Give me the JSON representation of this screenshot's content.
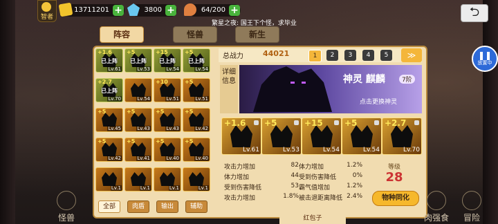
{
  "header": {
    "hint_label": "智者",
    "resources": [
      {
        "icon": "gold-icon",
        "value": "13711201"
      },
      {
        "icon": "diamond-icon",
        "value": "3800"
      },
      {
        "icon": "meat-icon",
        "value": "64/200"
      }
    ],
    "ticker": "繁星之夜: 国王下个怪，求毕业",
    "back_icon": "return-icon"
  },
  "tabs": [
    {
      "label": "阵容",
      "active": true
    },
    {
      "label": "怪兽",
      "active": false
    },
    {
      "label": "新生",
      "active": false
    }
  ],
  "roster": [
    {
      "plus": "+1.6",
      "status": "已上阵",
      "lv": "Lv.61",
      "on": true
    },
    {
      "plus": "+5",
      "status": "已上阵",
      "lv": "Lv.53",
      "on": true
    },
    {
      "plus": "+15",
      "status": "已上阵",
      "lv": "Lv.54",
      "on": true
    },
    {
      "plus": "+5",
      "status": "已上阵",
      "lv": "Lv.54",
      "on": true
    },
    {
      "plus": "+2.7",
      "status": "已上阵",
      "lv": "Lv.70",
      "on": true
    },
    {
      "plus": "",
      "status": "",
      "lv": "Lv.54",
      "on": false
    },
    {
      "plus": "+10",
      "status": "",
      "lv": "Lv.51",
      "on": false
    },
    {
      "plus": "+5",
      "status": "",
      "lv": "Lv.51",
      "on": false
    },
    {
      "plus": "+5",
      "status": "",
      "lv": "Lv.45",
      "on": false
    },
    {
      "plus": "+5",
      "status": "",
      "lv": "Lv.43",
      "on": false
    },
    {
      "plus": "+5",
      "status": "",
      "lv": "Lv.43",
      "on": false
    },
    {
      "plus": "+5",
      "status": "",
      "lv": "Lv.42",
      "on": false
    },
    {
      "plus": "+5",
      "status": "",
      "lv": "Lv.42",
      "on": false
    },
    {
      "plus": "+5",
      "status": "",
      "lv": "Lv.41",
      "on": false
    },
    {
      "plus": "+5",
      "status": "",
      "lv": "Lv.40",
      "on": false
    },
    {
      "plus": "+5",
      "status": "",
      "lv": "Lv.40",
      "on": false
    },
    {
      "plus": "",
      "status": "",
      "lv": "Lv.1",
      "on": false
    },
    {
      "plus": "",
      "status": "",
      "lv": "Lv.1",
      "on": false
    },
    {
      "plus": "",
      "status": "",
      "lv": "Lv.1",
      "on": false
    },
    {
      "plus": "",
      "status": "",
      "lv": "Lv.1",
      "on": false
    }
  ],
  "filters": [
    "全部",
    "肉盾",
    "输出",
    "辅助"
  ],
  "power": {
    "label": "总战力",
    "value": "44021"
  },
  "pages": [
    "1",
    "2",
    "3",
    "4",
    "5"
  ],
  "detail_label": "详细信息",
  "god": {
    "type": "神灵",
    "name": "麒麟",
    "tier": "7阶",
    "swap": "点击更换神灵"
  },
  "team": [
    {
      "plus": "+1.6",
      "lv": "Lv.61"
    },
    {
      "plus": "+5",
      "lv": "Lv.53"
    },
    {
      "plus": "+15",
      "lv": "Lv.54"
    },
    {
      "plus": "+5",
      "lv": "Lv.54"
    },
    {
      "plus": "+2.7",
      "lv": "Lv.70"
    }
  ],
  "stats": [
    {
      "a": "攻击力增加",
      "av": "82",
      "b": "体力增加",
      "bv": "1.2%"
    },
    {
      "a": "体力增加",
      "av": "44",
      "b": "受到伤害降低",
      "bv": "0%"
    },
    {
      "a": "受到伤害降低",
      "av": "53",
      "b": "霸气值增加",
      "bv": "1.2%"
    },
    {
      "a": "攻击力增加",
      "av": "1.8%",
      "b": "被击退距离降低",
      "bv": "2.4%"
    }
  ],
  "level": {
    "label": "等级",
    "value": "28"
  },
  "sync_button": "物种同化",
  "red_packet": "红包子",
  "bottom_left": "怪兽",
  "bottom_right": [
    "肉强食",
    "冒险"
  ],
  "pause_label": "放置中"
}
